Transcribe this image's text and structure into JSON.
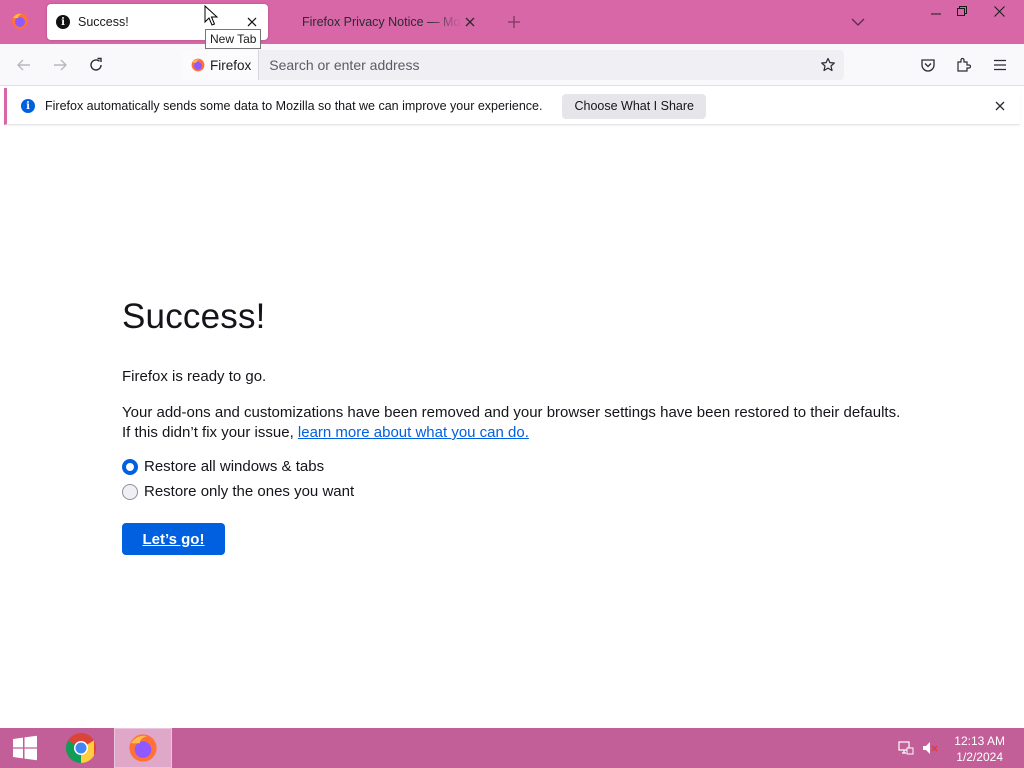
{
  "browser": {
    "tabs": [
      {
        "title": "Success!",
        "active": true
      },
      {
        "title": "Firefox Privacy Notice — Mozilla",
        "active": false
      }
    ],
    "tooltip": "New Tab"
  },
  "urlbar": {
    "identity_label": "Firefox",
    "placeholder": "Search or enter address"
  },
  "notice": {
    "text": "Firefox automatically sends some data to Mozilla so that we can improve your experience.",
    "button_label": "Choose What I Share"
  },
  "page": {
    "heading": "Success!",
    "ready_text": "Firefox is ready to go.",
    "description": "Your add-ons and customizations have been removed and your browser settings have been restored to their defaults.",
    "fix_prefix": "If this didn’t fix your issue, ",
    "learn_more_link": "learn more about what you can do.",
    "options": [
      {
        "label": "Restore all windows & tabs",
        "selected": true
      },
      {
        "label": "Restore only the ones you want",
        "selected": false
      }
    ],
    "go_button": "Let’s go!"
  },
  "taskbar": {
    "apps": [
      "Google Chrome",
      "Firefox"
    ],
    "time": "12:13 AM",
    "date": "1/2/2024"
  },
  "colors": {
    "titlebar": "#d867a7",
    "taskbar": "#c25e98",
    "accent": "#0060df"
  }
}
